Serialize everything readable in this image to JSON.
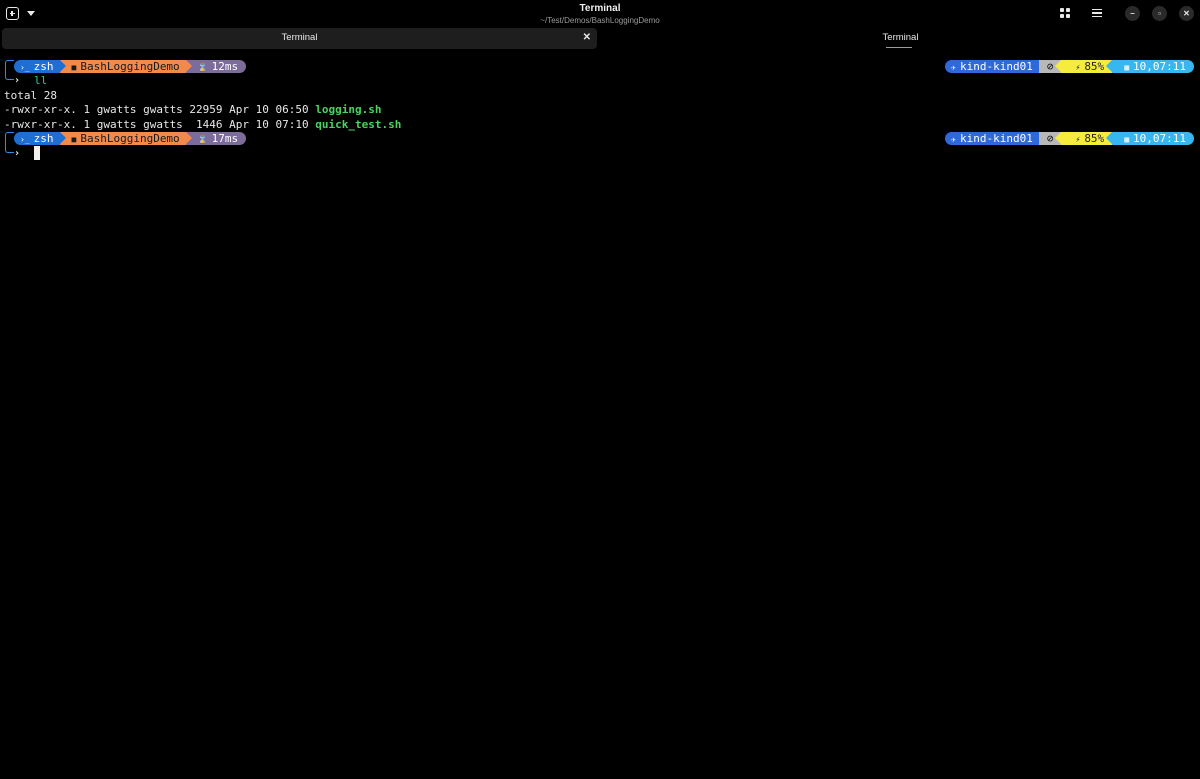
{
  "window": {
    "title": "Terminal",
    "subtitle": "~/Test/Demos/BashLoggingDemo",
    "controls": {
      "minimize": "–",
      "maximize": "▫",
      "close": "✕"
    }
  },
  "tabs": [
    {
      "label": "Terminal",
      "active": true,
      "close": "✕"
    },
    {
      "label": "Terminal",
      "active": false
    }
  ],
  "prompt1": {
    "shell": "zsh",
    "shell_icon": "›_",
    "dir": "BashLoggingDemo",
    "dir_icon": "■",
    "duration": "12ms",
    "duration_icon": "⌛",
    "k8s": "kind-kind01",
    "k8s_icon": "✈",
    "git_icon": "⊘",
    "battery": "85%",
    "battery_icon": "⚡",
    "clock": "10,07:11",
    "clock_icon": "▦"
  },
  "command": "ll",
  "output": {
    "total": "total 28",
    "files": [
      {
        "meta": "-rwxr-xr-x. 1 gwatts gwatts 22959 Apr 10 06:50 ",
        "name": "logging.sh"
      },
      {
        "meta": "-rwxr-xr-x. 1 gwatts gwatts  1446 Apr 10 07:10 ",
        "name": "quick_test.sh"
      }
    ]
  },
  "prompt2": {
    "shell": "zsh",
    "shell_icon": "›_",
    "dir": "BashLoggingDemo",
    "dir_icon": "■",
    "duration": "17ms",
    "duration_icon": "⌛",
    "k8s": "kind-kind01",
    "k8s_icon": "✈",
    "git_icon": "⊘",
    "battery": "85%",
    "battery_icon": "⚡",
    "clock": "10,07:11",
    "clock_icon": "▦"
  },
  "chevron": "›",
  "colors": {
    "shell_seg": "#1f6ed4",
    "dir_seg": "#f18a4a",
    "time_seg": "#7c6c9c",
    "k8s_seg": "#2f68d8",
    "git_seg": "#b8b8b8",
    "battery_seg": "#f5ec3f",
    "clock_seg": "#38b6f0",
    "command": "#30c8a8",
    "executable": "#46d65e"
  }
}
